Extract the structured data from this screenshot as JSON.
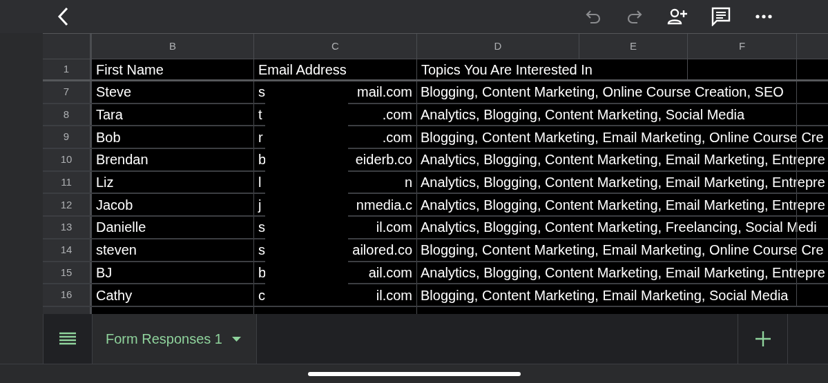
{
  "toolbar": {
    "undo_disabled": true,
    "redo_disabled": true
  },
  "columns": [
    "B",
    "C",
    "D",
    "E",
    "F"
  ],
  "header_row": {
    "number": "1",
    "first_name": "First Name",
    "email": "Email Address",
    "topics": "Topics You Are Interested In"
  },
  "rows": [
    {
      "number": "7",
      "first_name": "Steve",
      "email_start": "s",
      "email_end": "mail.com",
      "topics": "Blogging, Content Marketing, Online Course Creation, SEO"
    },
    {
      "number": "8",
      "first_name": "Tara",
      "email_start": "t",
      "email_end": ".com",
      "topics": "Analytics, Blogging, Content Marketing, Social Media"
    },
    {
      "number": "9",
      "first_name": "Bob",
      "email_start": "r",
      "email_end": ".com",
      "topics": "Blogging, Content Marketing, Email Marketing, Online Course Cre"
    },
    {
      "number": "10",
      "first_name": "Brendan",
      "email_start": "b",
      "email_end": "eiderb.co",
      "topics": "Analytics, Blogging, Content Marketing, Email Marketing, Entrepre"
    },
    {
      "number": "11",
      "first_name": "Liz",
      "email_start": "l",
      "email_end": "n",
      "topics": "Analytics, Blogging, Content Marketing, Email Marketing, Entrepre"
    },
    {
      "number": "12",
      "first_name": "Jacob",
      "email_start": "j",
      "email_end": "nmedia.c",
      "topics": "Analytics, Blogging, Content Marketing, Email Marketing, Entrepre"
    },
    {
      "number": "13",
      "first_name": "Danielle",
      "email_start": "s",
      "email_end": "il.com",
      "topics": "Analytics, Blogging, Content Marketing, Freelancing, Social Medi"
    },
    {
      "number": "14",
      "first_name": "steven",
      "email_start": "s",
      "email_end": "ailored.co",
      "topics": "Blogging, Content Marketing, Email Marketing, Online Course Cre"
    },
    {
      "number": "15",
      "first_name": "BJ",
      "email_start": "b",
      "email_end": "ail.com",
      "topics": "Analytics, Blogging, Content Marketing, Email Marketing, Entrepre"
    },
    {
      "number": "16",
      "first_name": "Cathy",
      "email_start": "c",
      "email_end": "il.com",
      "topics": "Blogging, Content Marketing, Email Marketing, Social Media"
    }
  ],
  "sheet_tabs": [
    {
      "label": "Form Responses 1",
      "selected": true
    }
  ]
}
